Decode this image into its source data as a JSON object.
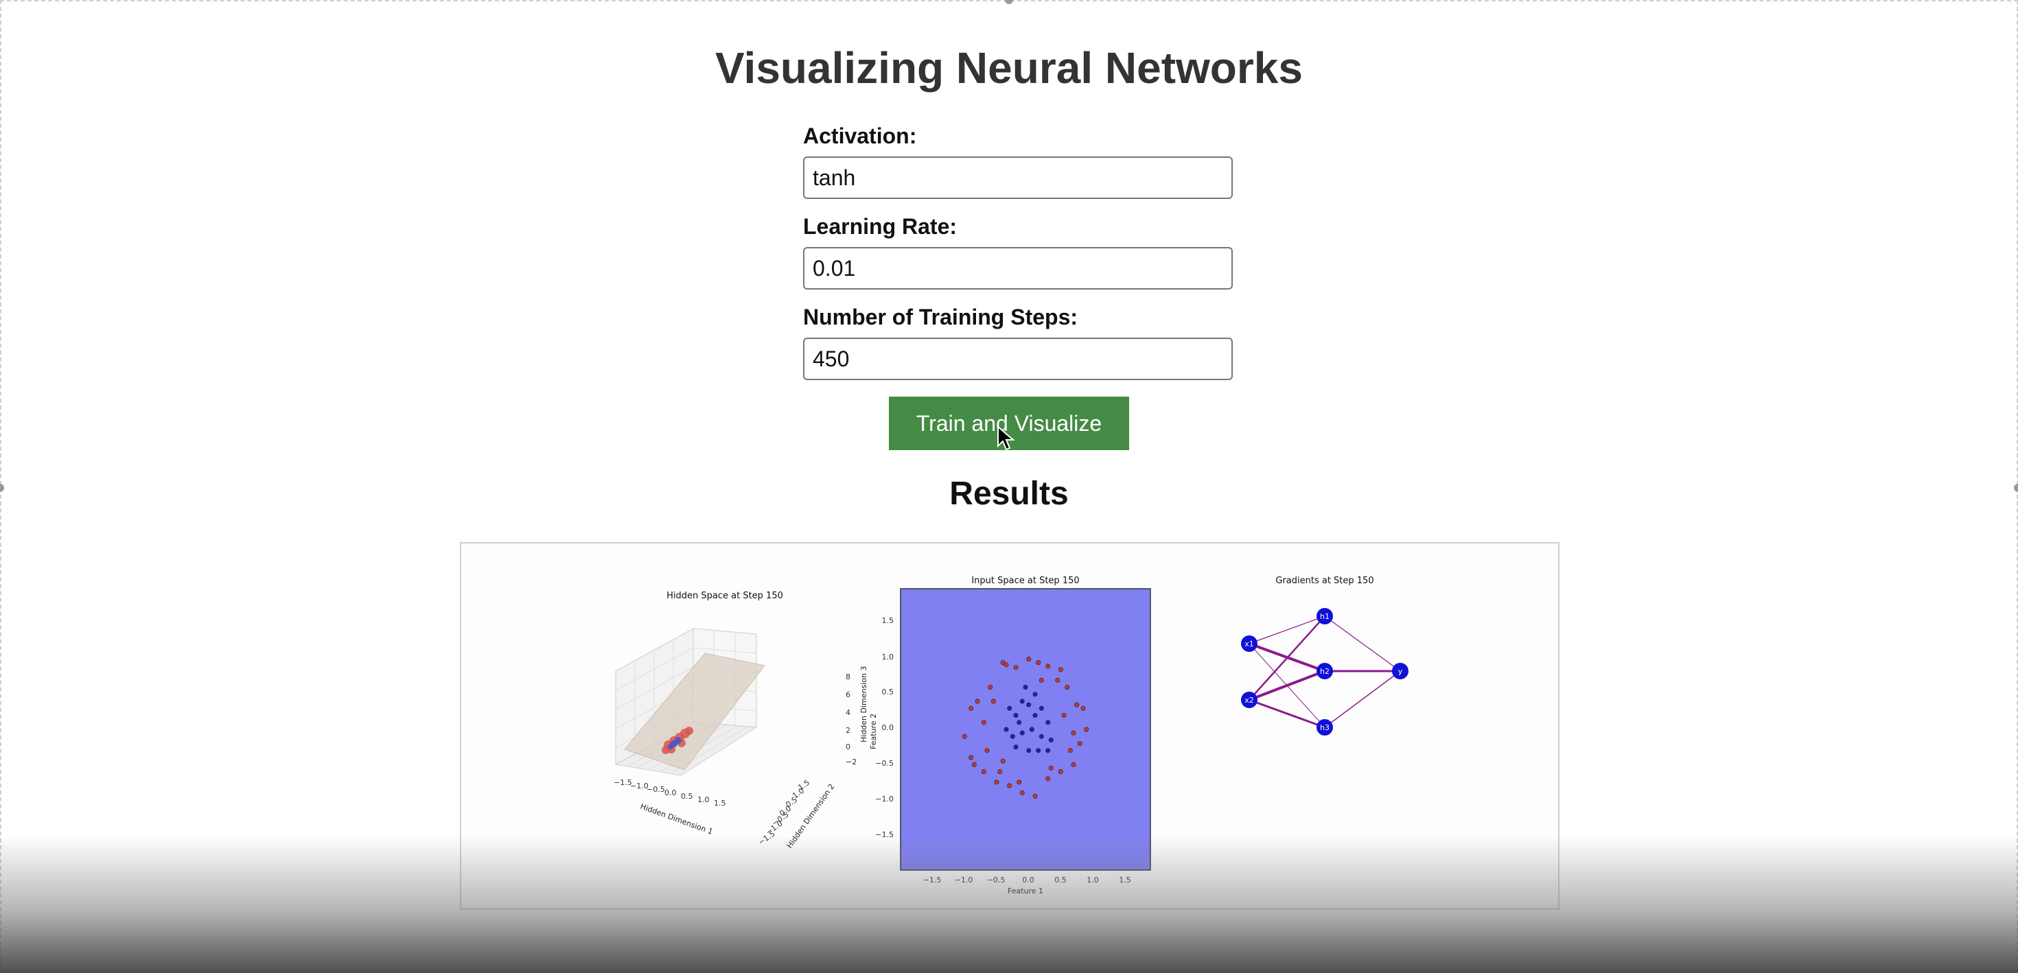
{
  "page": {
    "title": "Visualizing Neural Networks",
    "results_heading": "Results"
  },
  "form": {
    "activation_label": "Activation:",
    "activation_value": "tanh",
    "learning_rate_label": "Learning Rate:",
    "learning_rate_value": "0.01",
    "steps_label": "Number of Training Steps:",
    "steps_value": "450",
    "submit_label": "Train and Visualize"
  },
  "colors": {
    "button": "#458b45",
    "background_input_space": "#8080f2",
    "class_red": "#c0392b",
    "class_blue": "#2222aa",
    "gradient_edge": "#8b1a8b",
    "node": "#1010d8"
  },
  "plots": {
    "hidden_space": {
      "title": "Hidden Space at Step 150",
      "xlabel": "Hidden Dimension 1",
      "ylabel": "Hidden Dimension 2",
      "zlabel": "Hidden Dimension 3",
      "feature_label": "Feature 2",
      "x_ticks": [
        "−1.5",
        "−1.0",
        "−0.5",
        "0.0",
        "0.5",
        "1.0",
        "1.5"
      ],
      "y_ticks": [
        "−1.5",
        "−1.0",
        "−0.5",
        "0.0",
        "0.5",
        "1.0",
        "1.5"
      ],
      "z_ticks": [
        "−2",
        "0",
        "2",
        "4",
        "6",
        "8"
      ]
    },
    "input_space": {
      "title": "Input Space at Step 150",
      "xlabel": "Feature 1",
      "x_ticks": [
        "−1.5",
        "−1.0",
        "−0.5",
        "0.0",
        "0.5",
        "1.0",
        "1.5"
      ],
      "y_ticks": [
        "1.5",
        "1.0",
        "0.5",
        "0.0",
        "−0.5",
        "−1.0",
        "−1.5"
      ]
    },
    "gradients": {
      "title": "Gradients at Step 150",
      "nodes": [
        "x1",
        "x2",
        "h1",
        "h2",
        "h3",
        "y"
      ]
    }
  },
  "chart_data": [
    {
      "type": "scatter",
      "title": "Input Space at Step 150",
      "xlabel": "Feature 1",
      "ylabel": "",
      "xlim": [
        -2.0,
        1.9
      ],
      "ylim": [
        -2.0,
        2.0
      ],
      "series": [
        {
          "name": "",
          "color": "#c0392b",
          "points": [
            [
              -0.4,
              0.95
            ],
            [
              -0.35,
              0.92
            ],
            [
              -0.2,
              0.88
            ],
            [
              0.0,
              1.0
            ],
            [
              0.15,
              0.95
            ],
            [
              0.3,
              0.9
            ],
            [
              0.5,
              0.85
            ],
            [
              -0.6,
              0.6
            ],
            [
              -0.8,
              0.4
            ],
            [
              -0.9,
              0.3
            ],
            [
              -1.0,
              -0.1
            ],
            [
              -0.9,
              -0.4
            ],
            [
              -0.85,
              -0.5
            ],
            [
              -0.7,
              -0.6
            ],
            [
              -0.5,
              -0.75
            ],
            [
              -0.3,
              -0.8
            ],
            [
              -0.1,
              -0.9
            ],
            [
              0.1,
              -0.95
            ],
            [
              0.3,
              -0.7
            ],
            [
              0.5,
              -0.6
            ],
            [
              0.7,
              -0.5
            ],
            [
              0.8,
              -0.2
            ],
            [
              0.9,
              0.0
            ],
            [
              0.85,
              0.3
            ],
            [
              0.75,
              0.35
            ],
            [
              0.6,
              0.6
            ],
            [
              0.45,
              0.7
            ],
            [
              -0.55,
              0.4
            ],
            [
              -0.65,
              -0.3
            ],
            [
              -0.45,
              -0.6
            ],
            [
              0.65,
              -0.3
            ],
            [
              0.35,
              -0.55
            ],
            [
              -0.15,
              -0.75
            ],
            [
              0.2,
              0.7
            ],
            [
              -0.7,
              0.1
            ],
            [
              -0.4,
              -0.45
            ],
            [
              0.55,
              0.2
            ],
            [
              0.7,
              -0.05
            ]
          ]
        },
        {
          "name": "",
          "color": "#2222aa",
          "points": [
            [
              -0.3,
              0.3
            ],
            [
              -0.2,
              0.2
            ],
            [
              -0.1,
              0.4
            ],
            [
              0.0,
              0.35
            ],
            [
              0.1,
              0.2
            ],
            [
              0.2,
              0.3
            ],
            [
              0.3,
              0.1
            ],
            [
              -0.35,
              0.0
            ],
            [
              -0.25,
              -0.1
            ],
            [
              -0.1,
              -0.05
            ],
            [
              0.05,
              0.0
            ],
            [
              0.2,
              -0.1
            ],
            [
              0.35,
              -0.15
            ],
            [
              -0.2,
              -0.25
            ],
            [
              0.0,
              -0.3
            ],
            [
              0.15,
              -0.3
            ],
            [
              0.3,
              -0.3
            ],
            [
              -0.15,
              0.1
            ],
            [
              0.1,
              0.5
            ],
            [
              -0.05,
              0.6
            ]
          ]
        }
      ]
    }
  ]
}
